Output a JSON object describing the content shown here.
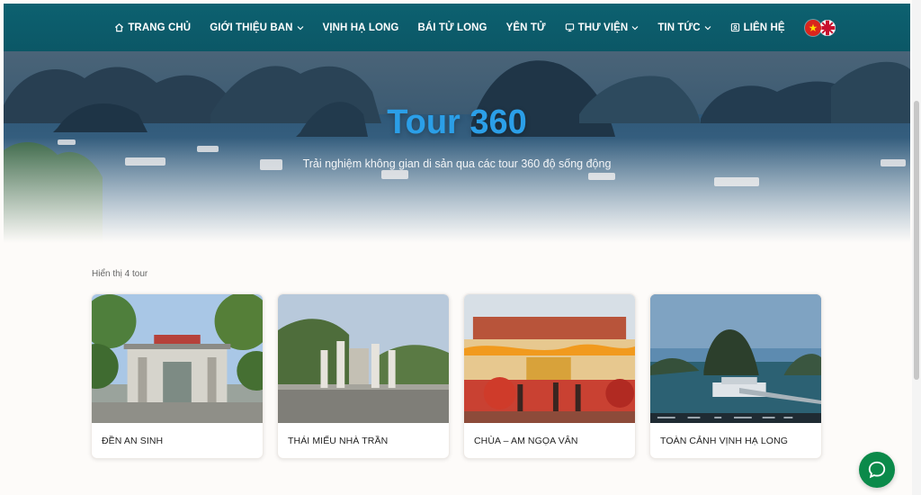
{
  "nav": {
    "items": [
      {
        "label": "TRANG CHỦ",
        "icon": "home-icon"
      },
      {
        "label": "GIỚI THIỆU BAN",
        "icon": "chevron-down-icon"
      },
      {
        "label": "VỊNH HẠ LONG"
      },
      {
        "label": "BÁI TỬ LONG"
      },
      {
        "label": "YÊN TỬ"
      },
      {
        "label": "THƯ VIỆN",
        "icon": "monitor-icon"
      },
      {
        "label": "TIN TỨC",
        "icon": "chevron-down-icon"
      },
      {
        "label": "LIÊN HỆ",
        "icon": "contact-icon"
      }
    ],
    "languages": [
      "vn-flag-icon",
      "uk-flag-icon"
    ],
    "colors": {
      "bar": "#0b5766",
      "text": "#ffffff"
    }
  },
  "hero": {
    "title": "Tour 360",
    "subtitle": "Trải nghiệm không gian di sản qua các tour 360 độ sống động",
    "colors": {
      "title": "#2b9fe8"
    }
  },
  "listing": {
    "count_label": "Hiển thị 4 tour",
    "tours": [
      {
        "title": "ĐỀN AN SINH"
      },
      {
        "title": "THÁI MIẾU NHÀ TRẦN"
      },
      {
        "title": "CHÙA – AM NGỌA VÂN"
      },
      {
        "title": "TOÀN CẢNH VỊNH HẠ LONG"
      }
    ]
  },
  "chat": {
    "icon": "chat-bubble-icon",
    "color": "#0b8a4a"
  }
}
